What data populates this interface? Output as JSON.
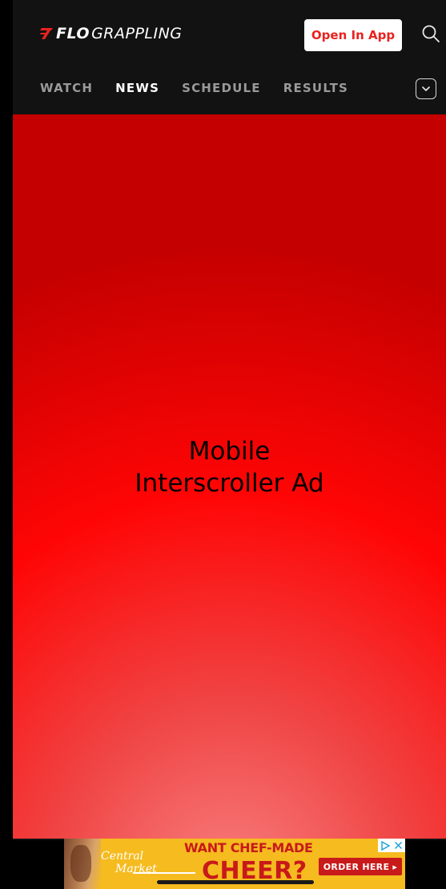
{
  "header": {
    "logo_flo": "FLO",
    "logo_name": "GRAPPLING",
    "open_app_label": "Open In App",
    "search_icon": "search-icon"
  },
  "nav": {
    "tabs": [
      {
        "label": "WATCH",
        "active": false
      },
      {
        "label": "NEWS",
        "active": true
      },
      {
        "label": "SCHEDULE",
        "active": false
      },
      {
        "label": "RESULTS",
        "active": false
      }
    ],
    "more_icon": "chevron-down-icon"
  },
  "ad": {
    "line1": "Mobile",
    "line2": "Interscroller Ad",
    "colors": {
      "top": "#c40000",
      "mid": "#ff0505",
      "bottom": "#f88282"
    }
  },
  "banner": {
    "brand_line1": "Central",
    "brand_line2": "Market",
    "headline": "WANT CHEF-MADE",
    "big_text": "CHEER?",
    "cta_label": "ORDER HERE ▸",
    "adchoices_icons": [
      "adchoices-icon",
      "close-icon"
    ],
    "colors": {
      "background": "#f5bb1f",
      "accent": "#c81a1a"
    }
  },
  "colors": {
    "brand_red": "#e8231f",
    "header_bg": "#121212"
  }
}
